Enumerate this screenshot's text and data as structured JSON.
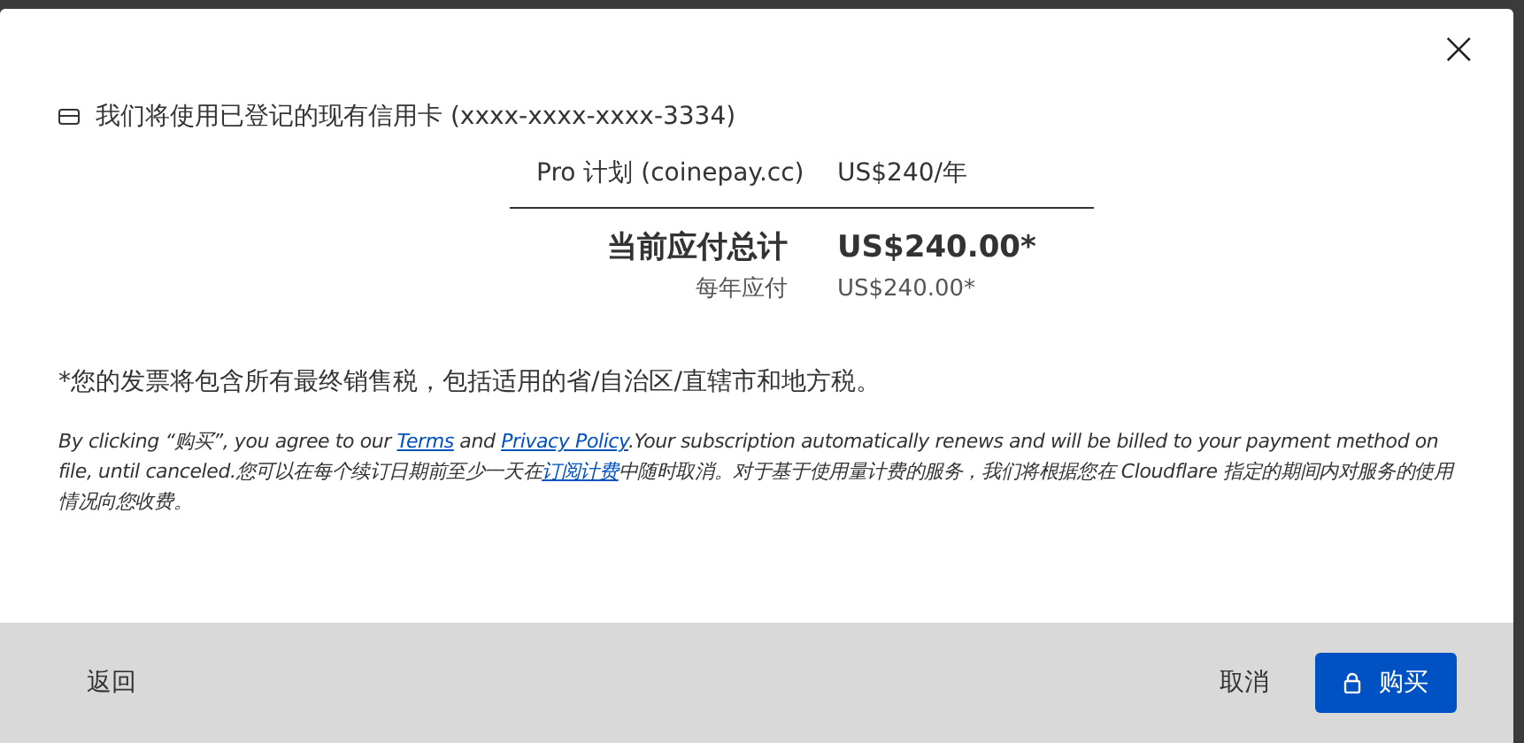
{
  "dialog": {
    "close_icon": "×",
    "card_notice": "我们将使用已登记的现有信用卡 (xxxx-xxxx-xxxx-3334)",
    "summary": [
      {
        "kind": "item",
        "label": "Pro 计划 (coinepay.cc)",
        "value": "US$240/年"
      },
      {
        "kind": "total",
        "label": "当前应付总计",
        "value": "US$240.00*"
      },
      {
        "kind": "recurring",
        "label": "每年应付",
        "value": "US$240.00*"
      }
    ],
    "tax_note": "*您的发票将包含所有最终销售税，包括适用的省/自治区/直辖市和地方税。",
    "legal": [
      {
        "kind": "text",
        "text": "By clicking “购买”, you agree to our "
      },
      {
        "kind": "link",
        "text": "Terms"
      },
      {
        "kind": "text",
        "text": " and "
      },
      {
        "kind": "link",
        "text": "Privacy Policy"
      },
      {
        "kind": "text",
        "text": ".Your subscription automatically renews and will be billed to your payment method on file, until canceled.您可以在每个续订日期前至少一天在"
      },
      {
        "kind": "link",
        "text": "订阅计费"
      },
      {
        "kind": "text",
        "text": "中随时取消。对于基于使用量计费的服务，我们将根据您在 Cloudflare 指定的期间内对服务的使用情况向您收费。"
      }
    ]
  },
  "footer": {
    "back": "返回",
    "cancel": "取消",
    "buy": "购买"
  }
}
